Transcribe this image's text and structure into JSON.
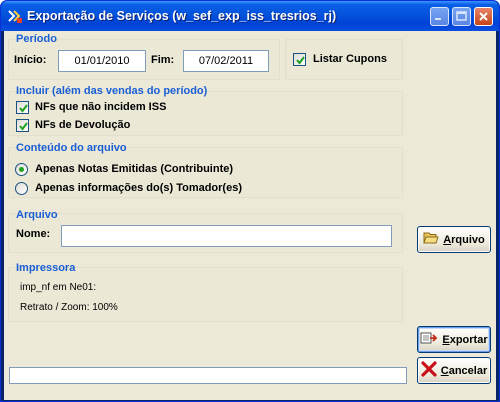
{
  "window": {
    "title": "Exportação de Serviços (w_sef_exp_iss_tresrios_rj)",
    "icon": "app-icon"
  },
  "periodo": {
    "title": "Período",
    "inicio_label": "Início:",
    "inicio_value": "01/01/2010",
    "fim_label": "Fim:",
    "fim_value": "07/02/2011",
    "listar_cupons_label": "Listar Cupons",
    "listar_cupons_checked": true
  },
  "incluir": {
    "title": "Incluir (além das vendas do período)",
    "options": [
      {
        "label": "NFs que não incidem ISS",
        "checked": true
      },
      {
        "label": "NFs de Devolução",
        "checked": true
      }
    ]
  },
  "conteudo": {
    "title": "Conteúdo do arquivo",
    "options": [
      {
        "label": "Apenas Notas Emitidas (Contribuinte)",
        "selected": true
      },
      {
        "label": "Apenas informações do(s) Tomador(es)",
        "selected": false
      }
    ]
  },
  "arquivo": {
    "title": "Arquivo",
    "nome_label": "Nome:",
    "nome_value": "",
    "button_label_rest": "rquivo",
    "button_label_underlined": "A"
  },
  "impressora": {
    "title": "Impressora",
    "line1": "imp_nf em Ne01:",
    "line2": "Retrato / Zoom: 100%"
  },
  "buttons": {
    "exportar_underlined": "E",
    "exportar_rest": "xportar",
    "cancelar_underlined": "C",
    "cancelar_rest": "ancelar"
  },
  "colors": {
    "group_title": "#1a5fd6",
    "face": "#ece9d8",
    "titlebar": "#0453dc"
  }
}
